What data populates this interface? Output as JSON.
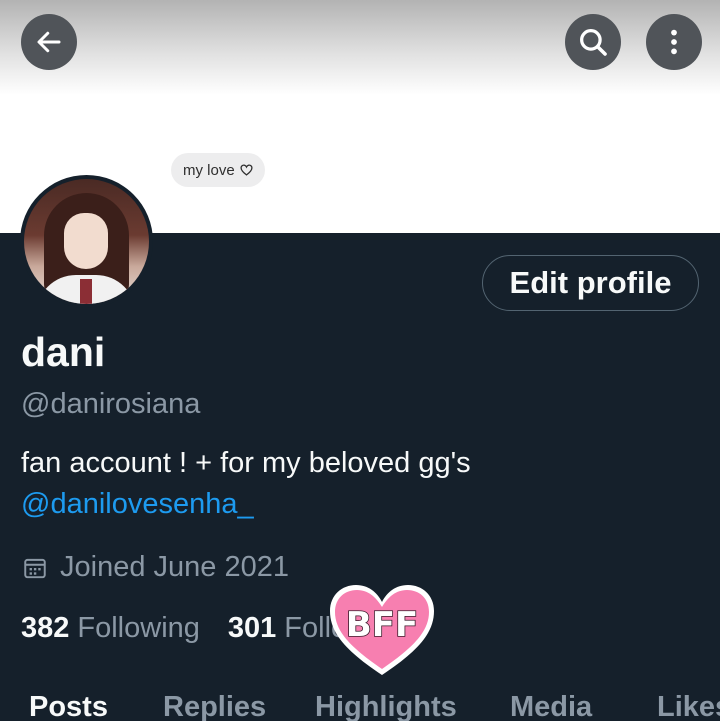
{
  "header": {
    "back_icon": "arrow-left-icon",
    "search_icon": "search-icon",
    "more_icon": "more-vertical-icon"
  },
  "banner": {
    "message_text": "my love"
  },
  "profile": {
    "edit_label": "Edit profile",
    "display_name": "dani",
    "handle": "@danirosiana",
    "bio": "fan account ! + for my beloved gg's",
    "bio_link": "@danilovesenha_",
    "joined": "Joined June 2021"
  },
  "stats": {
    "following_count": "382",
    "following_label": "Following",
    "followers_count": "301",
    "followers_label": "Followers"
  },
  "sticker": {
    "text": "BFF"
  },
  "tabs": [
    {
      "label": "Posts",
      "active": true
    },
    {
      "label": "Replies",
      "active": false
    },
    {
      "label": "Highlights",
      "active": false
    },
    {
      "label": "Media",
      "active": false
    },
    {
      "label": "Likes",
      "active": false
    }
  ],
  "colors": {
    "background": "#15202b",
    "accent": "#1d9bf0",
    "muted": "#8b98a5",
    "sticker": "#f77fb0"
  }
}
